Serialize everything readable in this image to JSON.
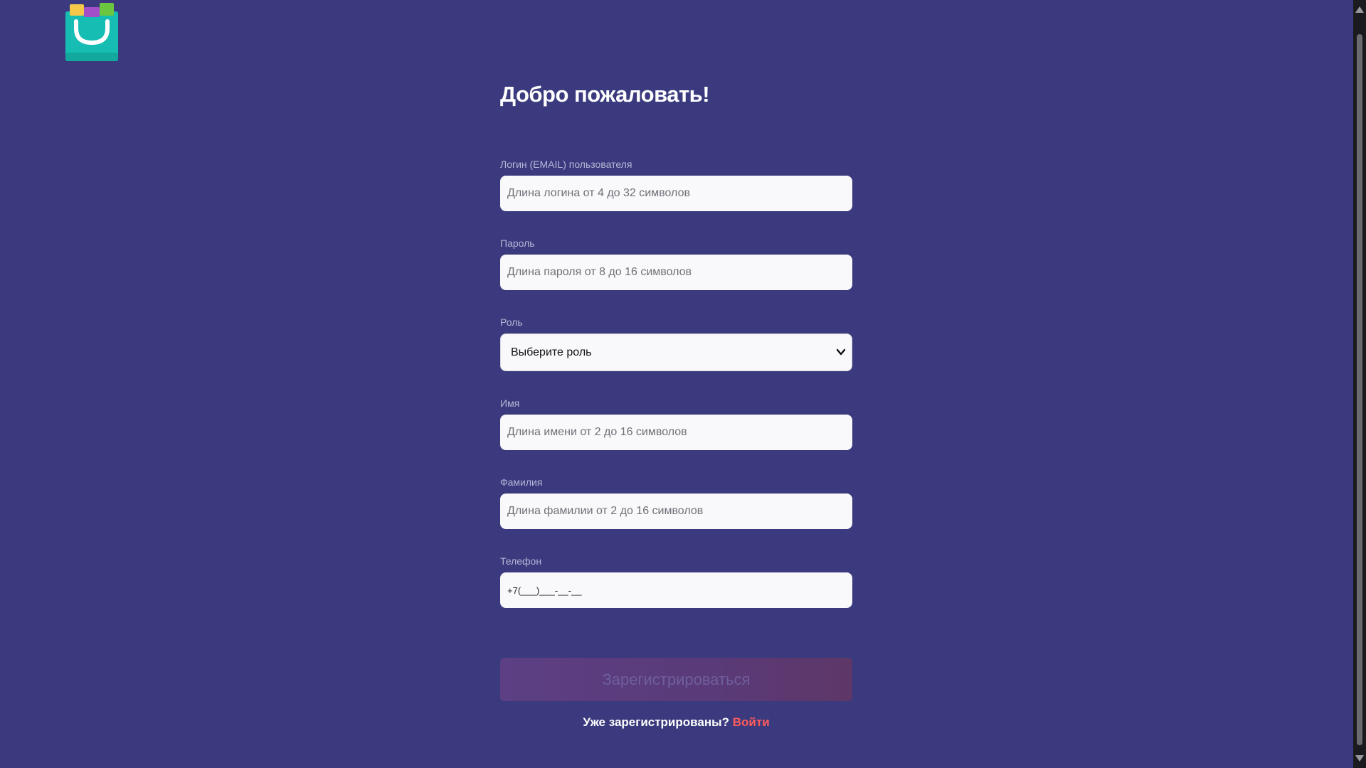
{
  "form": {
    "title": "Добро пожаловать!",
    "login": {
      "label": "Логин (EMAIL) пользователя",
      "placeholder": "Длина логина от 4 до 32 символов",
      "value": ""
    },
    "password": {
      "label": "Пароль",
      "placeholder": "Длина пароля от 8 до 16 символов",
      "value": ""
    },
    "role": {
      "label": "Роль",
      "selected": "Выберите роль"
    },
    "first_name": {
      "label": "Имя",
      "placeholder": "Длина имени от 2 до 16 символов",
      "value": ""
    },
    "last_name": {
      "label": "Фамилия",
      "placeholder": "Длина фамилии от 2 до 16 символов",
      "value": ""
    },
    "phone": {
      "label": "Телефон",
      "value": "+7(___)___-__-__"
    },
    "submit_label": "Зарегистрироваться",
    "already_registered": "Уже зарегистрированы?",
    "login_link": "Войти"
  },
  "logo": {
    "icon": "shopping-bag-logo-icon"
  },
  "colors": {
    "background": "#3b3a7e",
    "input_background": "#f9f9fb",
    "label": "#b7b6d6",
    "link": "#ff5b5b",
    "logo_teal": "#14bfb4"
  }
}
